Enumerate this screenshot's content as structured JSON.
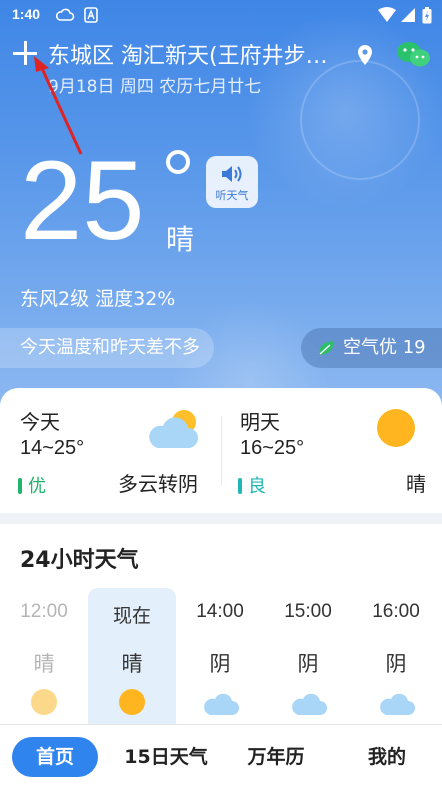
{
  "status": {
    "time": "1:40"
  },
  "header": {
    "location": "东城区 淘汇新天(王府井步…",
    "date": "9月18日 周四 农历七月廿七"
  },
  "current": {
    "temperature": "25",
    "condition": "晴",
    "listen_label": "听天气",
    "wind_humidity": "东风2级 湿度32%",
    "tip": "今天温度和昨天差不多",
    "air_quality": "空气优 19"
  },
  "days": [
    {
      "name": "今天",
      "range": "14~25°",
      "quality": "优",
      "quality_color": "#21b36b",
      "desc": "多云转阴",
      "icon": "partly-cloudy-icon"
    },
    {
      "name": "明天",
      "range": "16~25°",
      "quality": "良",
      "quality_color": "#20b6b4",
      "desc": "晴",
      "icon": "sun-icon"
    }
  ],
  "hourly": {
    "title": "24小时天气",
    "items": [
      {
        "time": "12:00",
        "weather": "晴",
        "icon": "sun-icon"
      },
      {
        "time": "现在",
        "weather": "晴",
        "icon": "sun-icon"
      },
      {
        "time": "14:00",
        "weather": "阴",
        "icon": "cloud-icon"
      },
      {
        "time": "15:00",
        "weather": "阴",
        "icon": "cloud-icon"
      },
      {
        "time": "16:00",
        "weather": "阴",
        "icon": "cloud-icon"
      }
    ]
  },
  "tabs": [
    {
      "label": "首页"
    },
    {
      "label": "15日天气"
    },
    {
      "label": "万年历"
    },
    {
      "label": "我的"
    }
  ],
  "colors": {
    "accent": "#2f84ee",
    "sky_top": "#3f86e6",
    "annotation_arrow": "#e02424"
  }
}
